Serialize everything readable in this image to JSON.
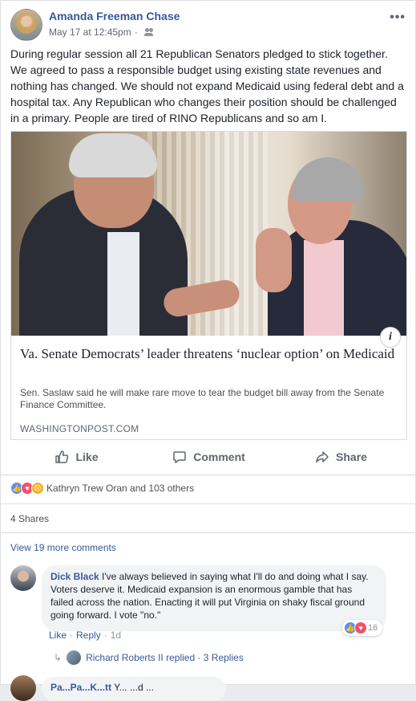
{
  "post": {
    "author": "Amanda Freeman Chase",
    "timestamp": "May 17 at 12:45pm",
    "dot": "·",
    "audience_icon": "friends-icon",
    "more_label": "•••",
    "text": "During regular session all 21 Republican Senators pledged to stick together. We agreed to pass a responsible budget using existing state revenues and nothing has changed. We should not expand Medicaid using federal debt and a hospital tax. Any Republican who changes their position should be challenged in a primary. People are tired of RINO Republicans and so am I."
  },
  "link_card": {
    "info_label": "i",
    "title": "Va. Senate Democrats’ leader threatens ‘nuclear option’ on Medicaid",
    "description": "Sen. Saslaw said he will make rare move to tear the budget bill away from the Senate Finance Committee.",
    "source": "WASHINGTONPOST.COM"
  },
  "actions": {
    "like": "Like",
    "comment": "Comment",
    "share": "Share"
  },
  "reactions": {
    "summary": "Kathryn Trew Oran and 103 others",
    "icons": [
      "like",
      "love",
      "angry"
    ]
  },
  "shares_label": "4 Shares",
  "view_more": "View 19 more comments",
  "comment": {
    "author": "Dick Black",
    "text": "I've always believed in saying what I'll do and doing what I say. Voters deserve it. Medicaid expansion is an enormous gamble that has failed across the nation. Enacting it will put Virginia on shaky fiscal ground going forward. I vote \"no.\"",
    "reaction_count": "16",
    "like": "Like",
    "reply": "Reply",
    "sep": "·",
    "time": "1d"
  },
  "replies": {
    "text": "Richard Roberts II replied · 3 Replies"
  },
  "next_comment": {
    "author": "Pa...Pa...K...tt",
    "text": "Y... ...d ..."
  },
  "colors": {
    "link_blue": "#385898",
    "author_blue": "#365899",
    "like_blue": "#5890ff",
    "love_red": "#f25268",
    "angry_yellow": "#f7b125"
  }
}
